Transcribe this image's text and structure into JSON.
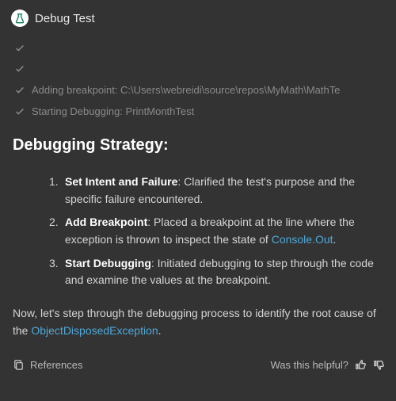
{
  "header": {
    "title": "Debug Test"
  },
  "status": [
    {
      "text": ""
    },
    {
      "text": ""
    },
    {
      "text": "Adding breakpoint: C:\\Users\\webreidi\\source\\repos\\MyMath\\MathTe"
    },
    {
      "text": "Starting Debugging: PrintMonthTest"
    }
  ],
  "section_heading": "Debugging Strategy:",
  "steps": [
    {
      "title": "Set Intent and Failure",
      "desc": ": Clarified the test's purpose and the specific failure encountered."
    },
    {
      "title": "Add Breakpoint",
      "desc_before": ": Placed a breakpoint at the line where the exception is thrown to inspect the state of ",
      "link": "Console.Out",
      "desc_after": "."
    },
    {
      "title": "Start Debugging",
      "desc": ": Initiated debugging to step through the code and examine the values at the breakpoint."
    }
  ],
  "paragraph": {
    "before": "Now, let's step through the debugging process to identify the root cause of the ",
    "link": "ObjectDisposedException",
    "after": "."
  },
  "footer": {
    "references": "References",
    "helpful": "Was this helpful?"
  }
}
